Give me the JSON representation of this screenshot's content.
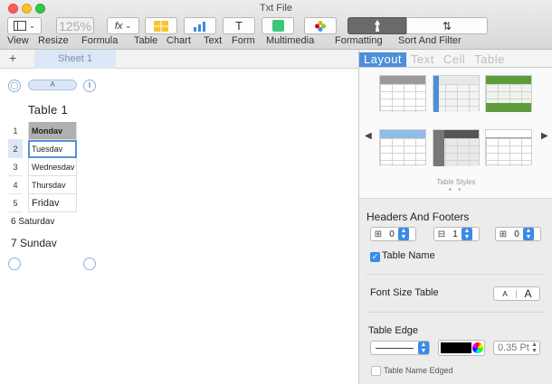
{
  "window": {
    "title": "Txt File"
  },
  "toolbar": {
    "zoom_value": "125%",
    "formula_icon": "fx",
    "text_icon": "T",
    "sort_icon": "⇅",
    "labels": {
      "view": "View",
      "resize": "Resize",
      "formula": "Formula",
      "table": "Table",
      "chart": "Chart",
      "text": "Text",
      "form": "Form",
      "multimedia": "Multimedia",
      "formatting": "Formatting",
      "sort_filter": "Sort And Filter"
    },
    "icons": [
      "sidebar-view-icon",
      "table-icon",
      "chart-icon",
      "text-icon",
      "shape-icon",
      "media-icon",
      "format-brush-icon",
      "sort-icon"
    ]
  },
  "sheets": {
    "add": "+",
    "tabs": [
      {
        "label": "Sheet 1"
      }
    ]
  },
  "table": {
    "column_header": "A",
    "title": "Table 1",
    "row_numbers": [
      "1",
      "2",
      "3",
      "4",
      "5"
    ],
    "cells": [
      "Mondav",
      "Tuesdav",
      "Wednesdav",
      "Thursdav",
      "Fridav"
    ],
    "row6": "6 Saturdav",
    "row7": "7 Sundav"
  },
  "inspector": {
    "tabs": [
      "Layout",
      "Text",
      "Cell",
      "Table"
    ],
    "active_tab": "Table",
    "styles_label": "Table Styles",
    "page_dots": "• •",
    "headers_footers": {
      "title": "Headers And Footers",
      "header_rows": "0",
      "header_columns": "1",
      "footer_rows": "0"
    },
    "table_name": {
      "label": "Table Name",
      "checked": true
    },
    "font_size": {
      "title": "Font Size Table",
      "small": "A",
      "large": "A"
    },
    "table_edge": {
      "title": "Table Edge",
      "stroke_color": "#000000",
      "width_value": "0.35 Pt",
      "name_edged_label": "Table Name Edged"
    }
  },
  "colors": {
    "accent": "#3b8be6",
    "selection": "#dbe7f6",
    "header_fill": "#b0b0b0"
  }
}
